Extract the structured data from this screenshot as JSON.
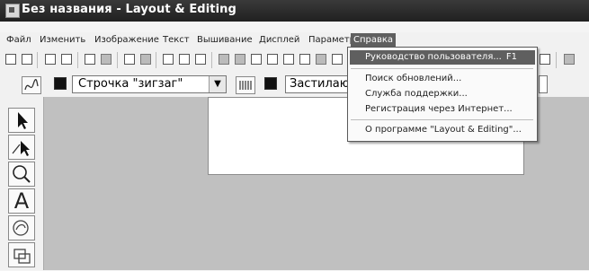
{
  "window": {
    "title": "Без названия - Layout & Editing"
  },
  "menu": {
    "items": [
      "Файл",
      "Изменить",
      "Изображение",
      "Текст",
      "Вышивание",
      "Дисплей",
      "Параметр",
      "Справка"
    ]
  },
  "toolbar2": {
    "stitch_combo_value": "Строчка \"зигзаг\"",
    "fill_label": "Застилаю"
  },
  "help_menu": {
    "items": [
      {
        "label": "Руководство пользователя...",
        "shortcut": "F1"
      },
      {
        "label": "Поиск обновлений..."
      },
      {
        "label": "Служба поддержки..."
      },
      {
        "label": "Регистрация через Интернет..."
      },
      {
        "label": "О программе \"Layout & Editing\"..."
      }
    ]
  },
  "tools": {
    "text_tool_glyph": "A"
  }
}
